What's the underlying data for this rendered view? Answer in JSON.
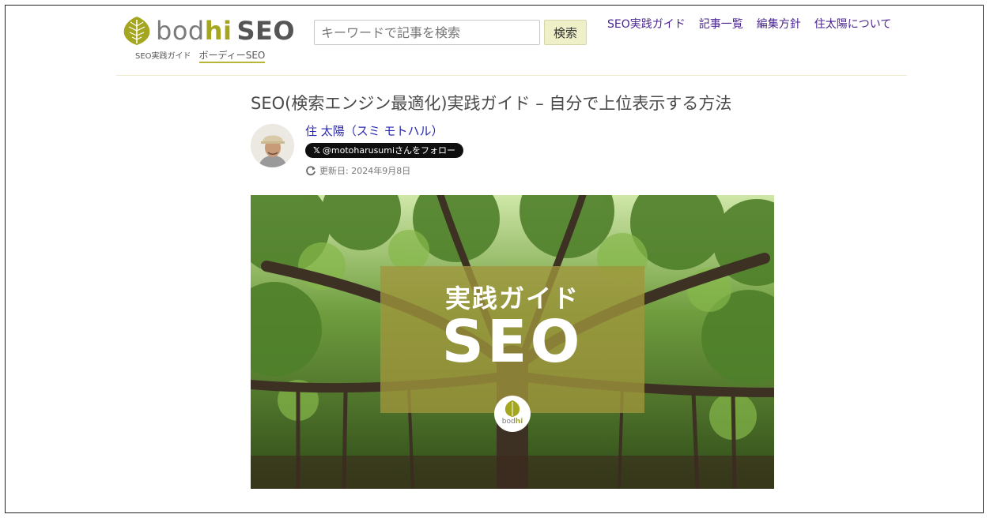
{
  "header": {
    "logo": {
      "word_1": "bod",
      "word_2": "hi",
      "word_3": "SEO",
      "tagline": "SEO実践ガイド",
      "kana": "ボーディーSEO"
    },
    "search": {
      "placeholder": "キーワードで記事を検索",
      "value": "",
      "button_label": "検索"
    },
    "nav": [
      {
        "label": "SEO実践ガイド"
      },
      {
        "label": "記事一覧"
      },
      {
        "label": "編集方針"
      },
      {
        "label": "住太陽について"
      }
    ]
  },
  "article": {
    "title": "SEO(検索エンジン最適化)実践ガイド – 自分で上位表示する方法",
    "author": {
      "name": "住 太陽（スミ モトハル）",
      "follow_label": "@motoharusumiさんをフォロー"
    },
    "updated": "更新日: 2024年9月8日",
    "hero": {
      "line_1": "実践ガイド",
      "line_2": "SEO",
      "badge_brand_1": "bod",
      "badge_brand_2": "hi"
    }
  },
  "colors": {
    "brand_olive": "#a5a620",
    "nav_link": "#4a2391",
    "author_link": "#2a2ab0",
    "search_button_bg": "#eff0c8"
  },
  "icons": [
    "leaf-logo-icon",
    "refresh-icon",
    "x-logo-icon"
  ]
}
